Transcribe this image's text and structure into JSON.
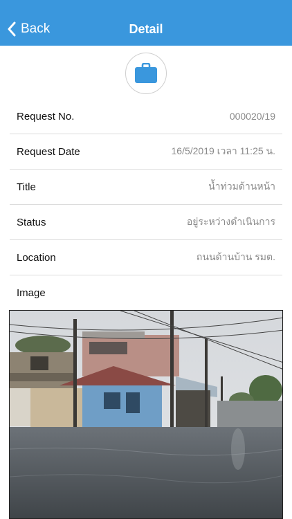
{
  "nav": {
    "back_label": "Back",
    "title": "Detail",
    "background": "#3a97dd"
  },
  "hero": {
    "icon": "briefcase-icon",
    "color": "#3a97dd"
  },
  "fields": [
    {
      "label": "Request No.",
      "value": "000020/19"
    },
    {
      "label": "Request Date",
      "value": "16/5/2019 เวลา 11:25 น."
    },
    {
      "label": "Title",
      "value": "น้ำท่วมด้านหน้า"
    },
    {
      "label": "Status",
      "value": "อยู่ระหว่างดำเนินการ"
    },
    {
      "label": "Location",
      "value": "ถนนด้านบ้าน รมต."
    }
  ],
  "image_section": {
    "label": "Image"
  }
}
